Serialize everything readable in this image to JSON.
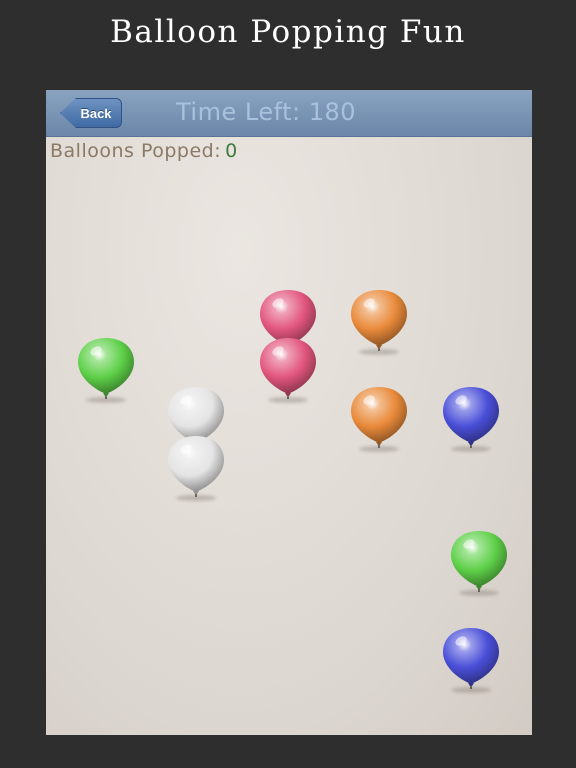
{
  "promo": {
    "title": "Balloon Popping Fun"
  },
  "header": {
    "back_label": "Back",
    "time_label": "Time Left:",
    "time_value": "180"
  },
  "score": {
    "label": "Balloons Popped:",
    "value": "0"
  },
  "colors": {
    "green": "#5ed048",
    "pink": "#e2567e",
    "orange": "#e98a3a",
    "white": "#e4e4e4",
    "blue": "#4a4fd8",
    "header_bar": "#7c96b8",
    "back_button": "#4a73aa",
    "timer_text": "#a9c1dc",
    "score_label": "#8a7a66",
    "score_value": "#3f7a3f"
  },
  "balloons": [
    {
      "color": "green",
      "icon": "balloon-icon"
    },
    {
      "color": "white",
      "icon": "balloon-icon"
    },
    {
      "color": "white",
      "icon": "balloon-icon"
    },
    {
      "color": "pink",
      "icon": "balloon-icon"
    },
    {
      "color": "pink",
      "icon": "balloon-icon"
    },
    {
      "color": "orange",
      "icon": "balloon-icon"
    },
    {
      "color": "orange",
      "icon": "balloon-icon"
    },
    {
      "color": "blue",
      "icon": "balloon-icon"
    },
    {
      "color": "green",
      "icon": "balloon-icon"
    },
    {
      "color": "blue",
      "icon": "balloon-icon"
    }
  ]
}
